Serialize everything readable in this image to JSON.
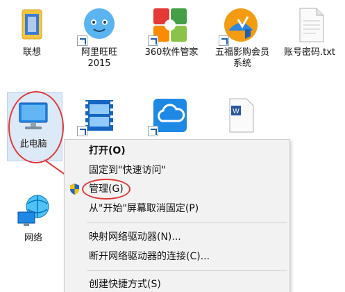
{
  "desktop": {
    "icons": [
      {
        "name": "lianxiang",
        "label": "联想"
      },
      {
        "name": "aliwangwang",
        "label": "阿里旺旺\n2015"
      },
      {
        "name": "360-software",
        "label": "360软件管家"
      },
      {
        "name": "wufu-member",
        "label": "五福影购会员\n系统"
      },
      {
        "name": "account-txt",
        "label": "账号密码.txt"
      },
      {
        "name": "this-pc",
        "label": "此电脑"
      },
      {
        "name": "video-player",
        "label": ""
      },
      {
        "name": "cloud",
        "label": ""
      },
      {
        "name": "word-doc",
        "label": ""
      },
      {
        "name": "network",
        "label": "网络"
      }
    ]
  },
  "context_menu": {
    "items": [
      {
        "label": "打开(O)",
        "bold": true
      },
      {
        "label": "固定到\"快速访问\""
      },
      {
        "label": "管理(G)",
        "icon": "shield-icon"
      },
      {
        "label": "从\"开始\"屏幕取消固定(P)"
      },
      {
        "label": "映射网络驱动器(N)..."
      },
      {
        "label": "断开网络驱动器的连接(C)..."
      },
      {
        "label": "创建快捷方式(S)"
      }
    ]
  },
  "colors": {
    "annotation_red": "#e03a3a",
    "selection_blue": "#dce9f6",
    "menu_bg": "#f2f2f2"
  }
}
